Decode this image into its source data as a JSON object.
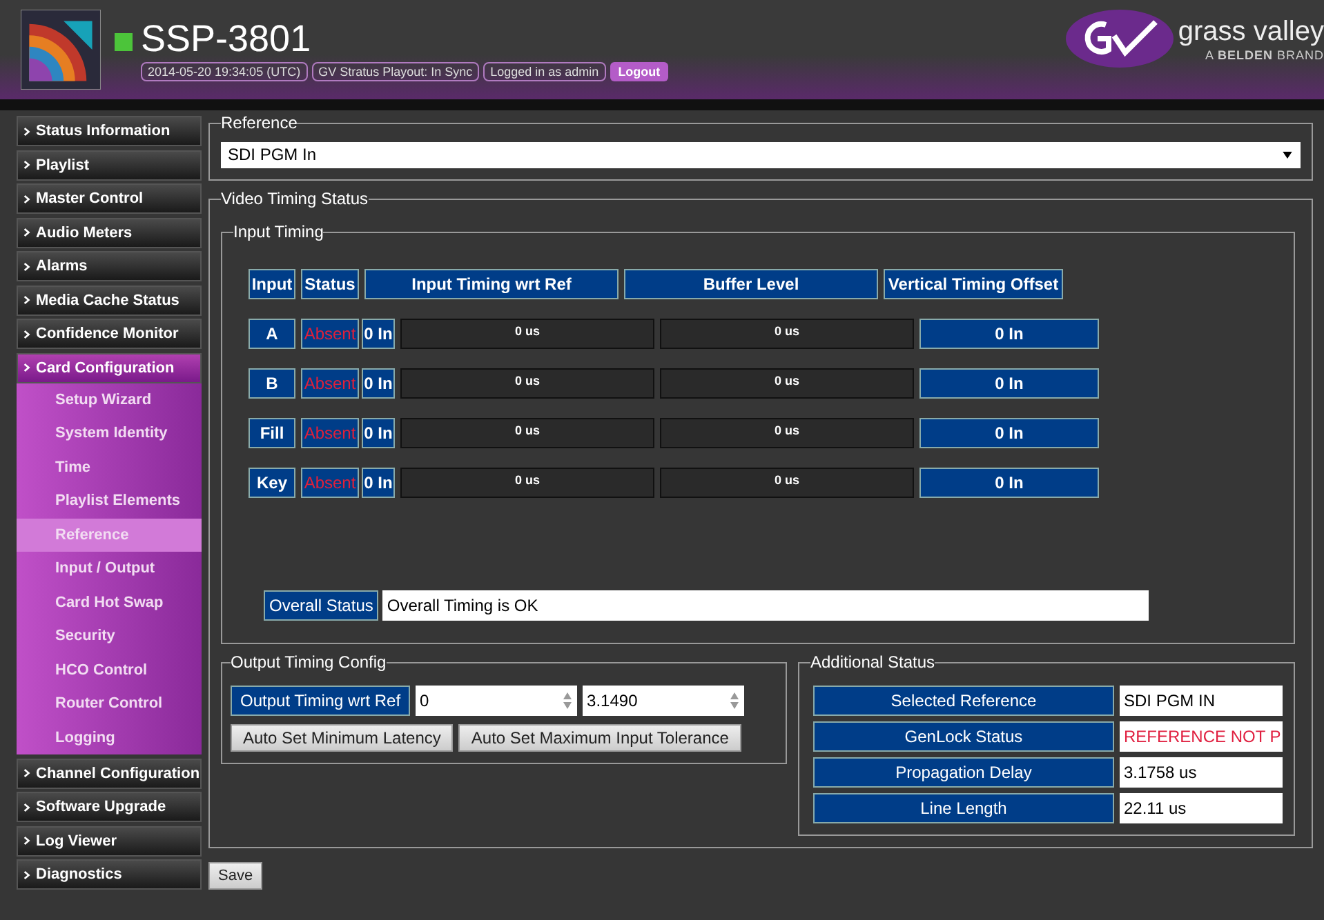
{
  "header": {
    "title": "SSP-3801",
    "status_items": [
      "2014-05-20 19:34:05 (UTC)",
      "GV Stratus Playout: In Sync",
      "Logged in as admin"
    ],
    "logout": "Logout",
    "brand": "grass valley",
    "brand_tagline": "A **BELDEN** BRAND"
  },
  "sidebar": {
    "items": [
      {
        "label": "Status Information",
        "expanded": false
      },
      {
        "label": "Playlist",
        "expanded": false
      },
      {
        "label": "Master Control",
        "expanded": false
      },
      {
        "label": "Audio Meters",
        "expanded": false
      },
      {
        "label": "Alarms",
        "expanded": false
      },
      {
        "label": "Media Cache Status",
        "expanded": false
      },
      {
        "label": "Confidence Monitor",
        "expanded": false
      },
      {
        "label": "Card Configuration",
        "expanded": true,
        "children": [
          {
            "label": "Setup Wizard",
            "selected": false
          },
          {
            "label": "System Identity",
            "selected": false
          },
          {
            "label": "Time",
            "selected": false
          },
          {
            "label": "Playlist Elements",
            "selected": false
          },
          {
            "label": "Reference",
            "selected": true
          },
          {
            "label": "Input / Output",
            "selected": false
          },
          {
            "label": "Card Hot Swap",
            "selected": false
          },
          {
            "label": "Security",
            "selected": false
          },
          {
            "label": "HCO Control",
            "selected": false
          },
          {
            "label": "Router Control",
            "selected": false
          },
          {
            "label": "Logging",
            "selected": false
          }
        ]
      },
      {
        "label": "Channel Configuration",
        "expanded": false
      },
      {
        "label": "Software Upgrade",
        "expanded": false
      },
      {
        "label": "Log Viewer",
        "expanded": false
      },
      {
        "label": "Diagnostics",
        "expanded": false
      }
    ]
  },
  "reference": {
    "legend": "Reference",
    "value": "SDI PGM In"
  },
  "video_timing": {
    "legend": "Video Timing Status",
    "input_timing": {
      "legend": "Input Timing",
      "columns": [
        "Input",
        "Status",
        "Input Timing wrt Ref",
        "Buffer Level",
        "Vertical Timing Offset"
      ],
      "rows": [
        {
          "input": "A",
          "status": "Absent",
          "lines": "0 In",
          "timing": "0 us",
          "buffer": "0 us",
          "offset": "0 In"
        },
        {
          "input": "B",
          "status": "Absent",
          "lines": "0 In",
          "timing": "0 us",
          "buffer": "0 us",
          "offset": "0 In"
        },
        {
          "input": "Fill",
          "status": "Absent",
          "lines": "0 In",
          "timing": "0 us",
          "buffer": "0 us",
          "offset": "0 In"
        },
        {
          "input": "Key",
          "status": "Absent",
          "lines": "0 In",
          "timing": "0 us",
          "buffer": "0 us",
          "offset": "0 In"
        }
      ],
      "overall_label": "Overall Status",
      "overall_value": "Overall Timing is OK"
    },
    "output_timing": {
      "legend": "Output Timing Config",
      "label": "Output Timing wrt Ref",
      "value_1": "0",
      "value_2": "3.1490",
      "buttons": [
        "Auto Set Minimum Latency",
        "Auto Set Maximum Input Tolerance"
      ]
    },
    "additional_status": {
      "legend": "Additional Status",
      "rows": [
        {
          "label": "Selected Reference",
          "value": "SDI PGM IN",
          "alert": false
        },
        {
          "label": "GenLock Status",
          "value": "REFERENCE NOT P",
          "alert": true
        },
        {
          "label": "Propagation Delay",
          "value": "3.1758 us",
          "alert": false
        },
        {
          "label": "Line Length",
          "value": "22.11 us",
          "alert": false
        }
      ]
    }
  },
  "save": "Save"
}
